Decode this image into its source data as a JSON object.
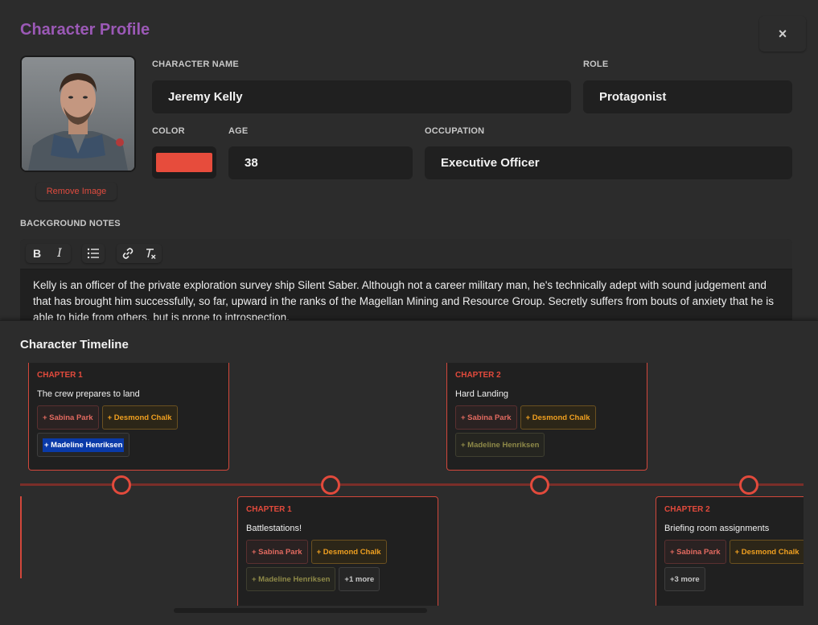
{
  "dialog": {
    "title": "Character Profile",
    "close_label": "×"
  },
  "avatar": {
    "remove_label": "Remove Image"
  },
  "fields": {
    "name_label": "CHARACTER NAME",
    "name_value": "Jeremy Kelly",
    "role_label": "ROLE",
    "role_value": "Protagonist",
    "color_label": "COLOR",
    "color_value": "#e74c3c",
    "age_label": "AGE",
    "age_value": "38",
    "occupation_label": "OCCUPATION",
    "occupation_value": "Executive Officer"
  },
  "notes": {
    "label": "BACKGROUND NOTES",
    "toolbar": [
      "bold-icon",
      "italic-icon",
      "bullet-list-icon",
      "link-icon",
      "clear-format-icon"
    ],
    "text": "Kelly is an officer of the private exploration survey ship Silent Saber. Although not a career military man, he's technically adept with sound judgement and that has brought him successfully, so far, upward in the ranks of the Magellan Mining  and Resource Group. Secretly suffers from bouts of anxiety that he is able to hide from others, but is prone to introspection."
  },
  "timeline": {
    "title": "Character Timeline",
    "events": [
      {
        "chapter": "CHAPTER 1",
        "title": "The crew prepares to land",
        "chips": [
          {
            "label": "+ Sabina Park",
            "style": "red"
          },
          {
            "label": "+ Desmond Chalk",
            "style": "orange"
          },
          {
            "label": "+ Madeline Henriksen",
            "style": "blue"
          }
        ]
      },
      {
        "chapter": "CHAPTER 1",
        "title": "Battlestations!",
        "chips": [
          {
            "label": "+ Sabina Park",
            "style": "red"
          },
          {
            "label": "+ Desmond Chalk",
            "style": "orange"
          },
          {
            "label": "+ Madeline Henriksen",
            "style": "olive"
          },
          {
            "label": "+1 more",
            "style": "more"
          }
        ]
      },
      {
        "chapter": "CHAPTER 2",
        "title": "Hard Landing",
        "chips": [
          {
            "label": "+ Sabina Park",
            "style": "red"
          },
          {
            "label": "+ Desmond Chalk",
            "style": "orange"
          },
          {
            "label": "+ Madeline Henriksen",
            "style": "olive"
          }
        ]
      },
      {
        "chapter": "CHAPTER 2",
        "title": "Briefing room assignments",
        "chips": [
          {
            "label": "+ Sabina Park",
            "style": "red"
          },
          {
            "label": "+ Desmond Chalk",
            "style": "orange"
          },
          {
            "label": "+3 more",
            "style": "more"
          }
        ]
      }
    ]
  },
  "colors": {
    "accent_purple": "#9b59b6",
    "accent_red": "#e24a3c"
  }
}
